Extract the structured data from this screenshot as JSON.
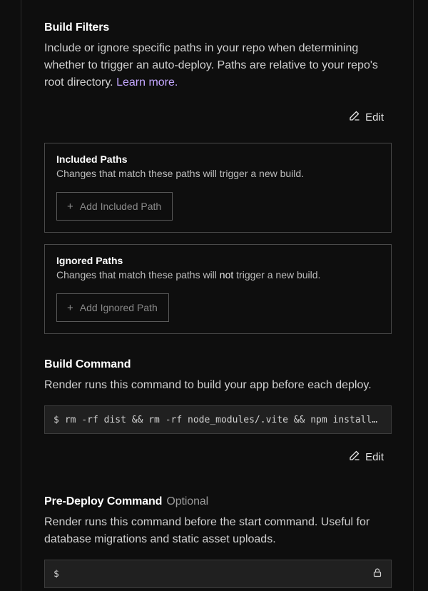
{
  "build_filters": {
    "title": "Build Filters",
    "description": "Include or ignore specific paths in your repo when determining whether to trigger an auto-deploy. Paths are relative to your repo's root directory.",
    "learn_more": "Learn more.",
    "edit_label": "Edit",
    "included": {
      "title": "Included Paths",
      "description": "Changes that match these paths will trigger a new build.",
      "add_label": "Add Included Path"
    },
    "ignored": {
      "title": "Ignored Paths",
      "description_before": "Changes that match these paths will ",
      "description_emphasis": "not",
      "description_after": " trigger a new build.",
      "add_label": "Add Ignored Path"
    }
  },
  "build_command": {
    "title": "Build Command",
    "description": "Render runs this command to build your app before each deploy.",
    "prompt": "$",
    "value": "rm -rf dist && rm -rf node_modules/.vite && npm install …",
    "edit_label": "Edit"
  },
  "pre_deploy_command": {
    "title": "Pre-Deploy Command",
    "optional_label": "Optional",
    "description": "Render runs this command before the start command. Useful for database migrations and static asset uploads.",
    "prompt": "$",
    "value": "",
    "lock_icon": "lock-icon"
  },
  "colors": {
    "background": "#0e0e0e",
    "link": "#c4a7ff",
    "border": "#4a4a4a",
    "input_bg": "#202020"
  }
}
